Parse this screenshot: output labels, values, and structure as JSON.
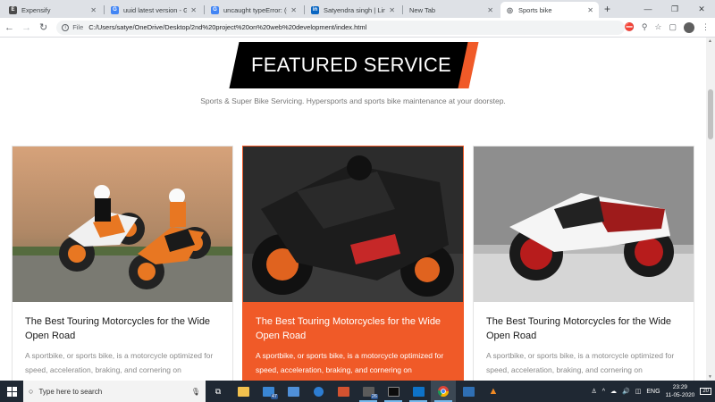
{
  "browser": {
    "tabs": [
      {
        "label": "Expensify",
        "favicon": "E",
        "fav_color": "#4b4b4b"
      },
      {
        "label": "uuid latest version - Go",
        "favicon": "G",
        "fav_color": "#4285f4"
      },
      {
        "label": "uncaught typeError: (0",
        "favicon": "G",
        "fav_color": "#4285f4"
      },
      {
        "label": "Satyendra singh | Linke",
        "favicon": "in",
        "fav_color": "#0a66c2"
      },
      {
        "label": "New Tab",
        "favicon": "",
        "fav_color": "#dee1e6"
      },
      {
        "label": "Sports bike",
        "favicon": "◎",
        "fav_color": "#5f6368"
      }
    ],
    "new_tab_symbol": "+",
    "window_controls": {
      "minimize": "—",
      "maximize": "❐",
      "close": "✕"
    },
    "address": {
      "scheme_label": "File",
      "url": "C:/Users/satye/OneDrive/Desktop/2nd%20project%20on%20web%20development/index.html"
    }
  },
  "page": {
    "banner_title": "FEATURED SERVICE",
    "subtitle": "Sports & Super Bike Servicing. Hypersports and sports bike maintenance at your doorstep.",
    "cards": [
      {
        "title": "The Best Touring Motorcycles for the Wide Open Road",
        "desc": "A sportbike, or sports bike, is a motorcycle optimized for speed, acceleration, braking, and cornering on",
        "highlight": false
      },
      {
        "title": "The Best Touring Motorcycles for the Wide Open Road",
        "desc": "A sportbike, or sports bike, is a motorcycle optimized for speed, acceleration, braking, and cornering on",
        "highlight": true
      },
      {
        "title": "The Best Touring Motorcycles for the Wide Open Road",
        "desc": "A sportbike, or sports bike, is a motorcycle optimized for speed, acceleration, braking, and cornering on",
        "highlight": false
      }
    ]
  },
  "taskbar": {
    "search_placeholder": "Type here to search",
    "mail_badge": "47",
    "files_badge": "26",
    "language": "ENG",
    "time": "23:29",
    "date": "11-05-2020",
    "notification_count": "20"
  },
  "colors": {
    "accent": "#f05a28",
    "banner_black": "#000000",
    "taskbar": "#1f2833"
  }
}
